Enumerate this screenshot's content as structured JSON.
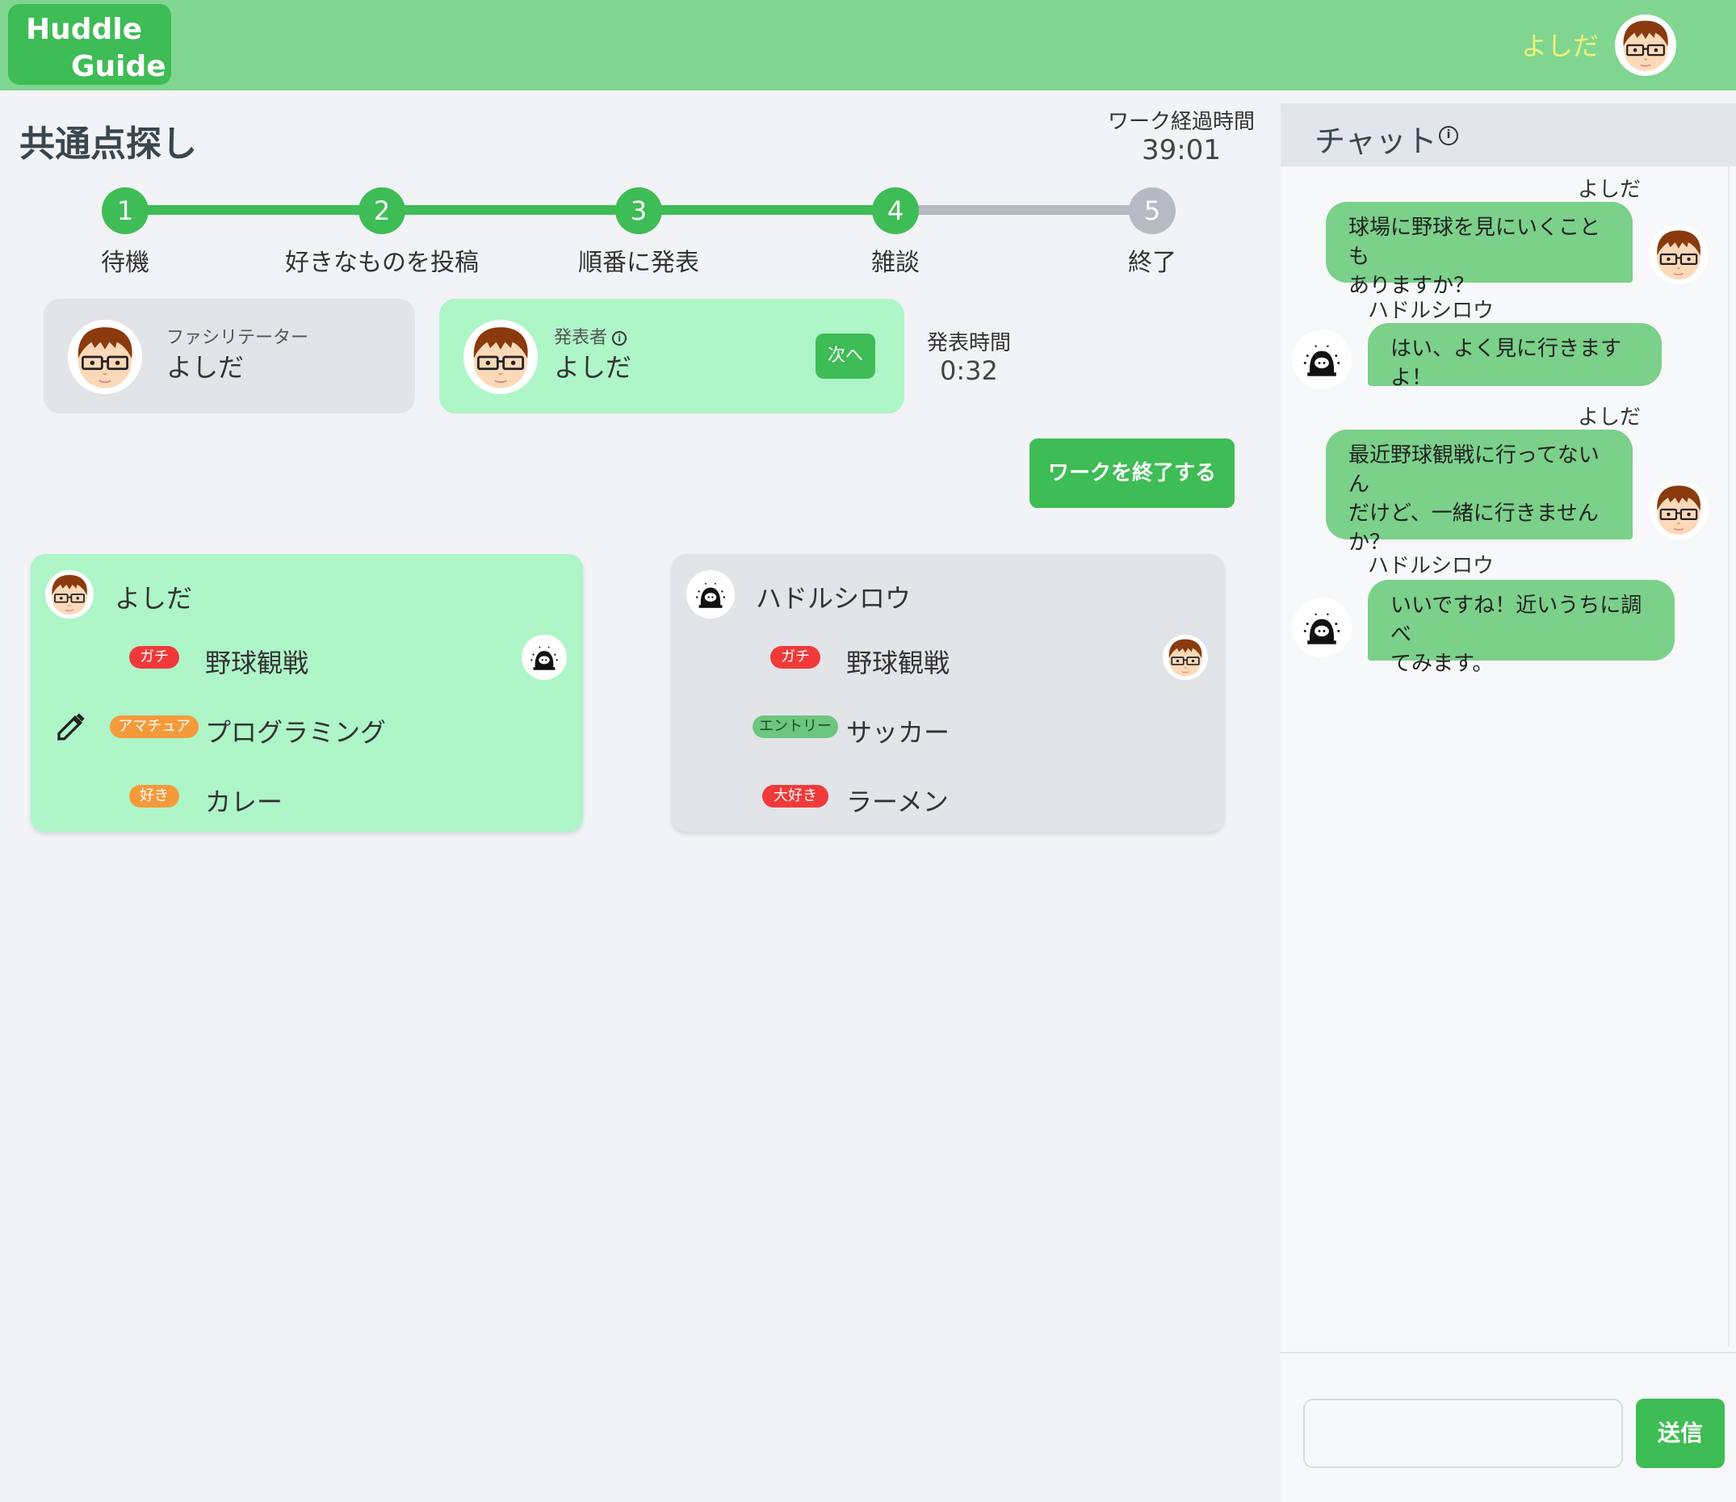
{
  "header": {
    "logo_line1": "Huddle",
    "logo_line2": "Guide",
    "user_name": "よしだ"
  },
  "work": {
    "title": "共通点探し",
    "elapsed_label": "ワーク経過時間",
    "elapsed_time": "39:01",
    "steps": [
      {
        "number": "1",
        "label": "待機",
        "status": "done"
      },
      {
        "number": "2",
        "label": "好きなものを投稿",
        "status": "done"
      },
      {
        "number": "3",
        "label": "順番に発表",
        "status": "done"
      },
      {
        "number": "4",
        "label": "雑談",
        "status": "current"
      },
      {
        "number": "5",
        "label": "終了",
        "status": "todo"
      }
    ],
    "facilitator": {
      "role": "ファシリテーター",
      "name": "よしだ"
    },
    "presenter": {
      "role": "発表者",
      "name": "よしだ",
      "next_label": "次へ"
    },
    "presentation_time_label": "発表時間",
    "presentation_time": "0:32",
    "end_button_label": "ワークを終了する"
  },
  "members": [
    {
      "name": "よしだ",
      "likes": [
        {
          "level": "ガチ",
          "level_color": "#f03a3a",
          "item": "野球観戦",
          "matched_with": "ハドルシロウ"
        },
        {
          "level": "アマチュア",
          "level_color": "#f59a3b",
          "item": "プログラミング"
        },
        {
          "level": "好き",
          "level_color": "#f59a3b",
          "item": "カレー"
        }
      ]
    },
    {
      "name": "ハドルシロウ",
      "likes": [
        {
          "level": "ガチ",
          "level_color": "#f03a3a",
          "item": "野球観戦",
          "matched_with": "よしだ"
        },
        {
          "level": "エントリー",
          "level_color": "#6cc77e",
          "item": "サッカー"
        },
        {
          "level": "大好き",
          "level_color": "#f03a3a",
          "item": "ラーメン"
        }
      ]
    }
  ],
  "chat": {
    "title": "チャット",
    "messages": [
      {
        "sender": "よしだ",
        "text": "球場に野球を見にいくことも\nありますか？",
        "side": "right"
      },
      {
        "sender": "ハドルシロウ",
        "text": "はい、よく見に行きますよ！",
        "side": "left"
      },
      {
        "sender": "よしだ",
        "text": "最近野球観戦に行ってないん\nだけど、一緒に行きません\nか？",
        "side": "right"
      },
      {
        "sender": "ハドルシロウ",
        "text": "いいですね！近いうちに調べ\nてみます。",
        "side": "left"
      }
    ],
    "input_value": "",
    "send_label": "送信"
  },
  "colors": {
    "header_bg": "#80d690",
    "accent": "#3ebc55",
    "highlight_card": "#aef5c8",
    "neutral_card": "#e3e4e8",
    "chat_bubble": "#7bd08a"
  },
  "icons": {
    "user_avatar": "boy-with-glasses-avatar",
    "bot_avatar": "hooded-character-avatar",
    "edit": "pencil-icon",
    "info": "info-icon"
  }
}
